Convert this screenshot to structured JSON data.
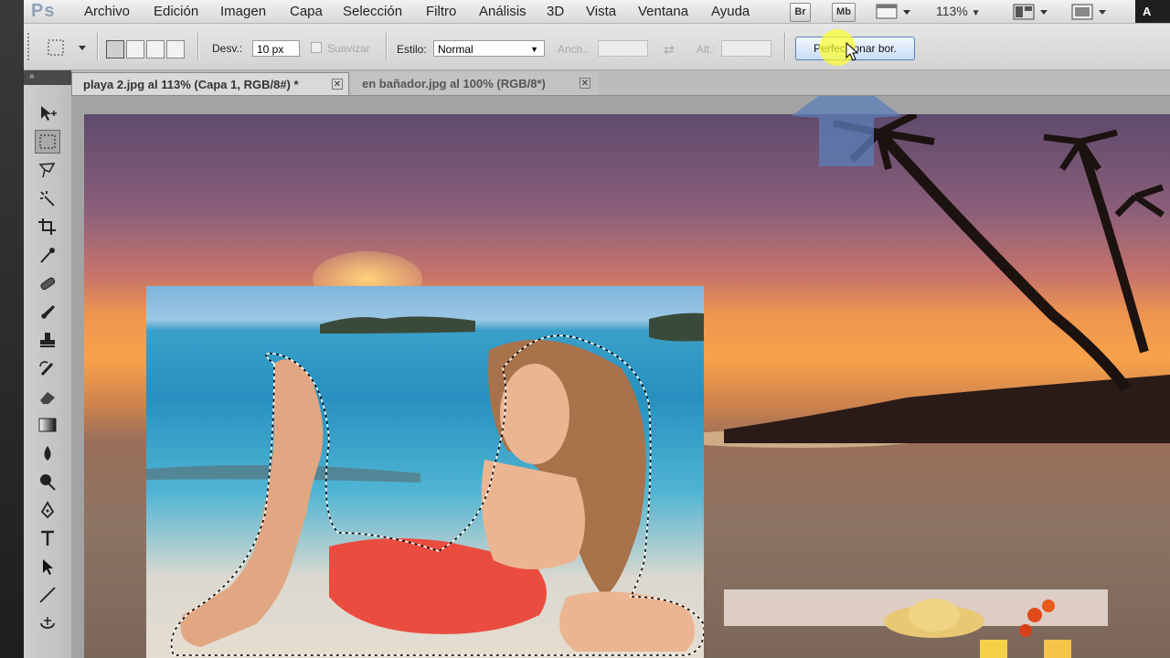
{
  "app": {
    "logo": "Ps"
  },
  "menu": [
    "Archivo",
    "Edición",
    "Imagen",
    "Capa",
    "Selección",
    "Filtro",
    "Análisis",
    "3D",
    "Vista",
    "Ventana",
    "Ayuda"
  ],
  "toolbar_right": {
    "bridge": "Br",
    "mini_bridge": "Mb",
    "zoom": "113%",
    "workspace": "A"
  },
  "options": {
    "feather_label": "Desv.:",
    "feather_value": "10 px",
    "antialias_label": "Suavizar",
    "style_label": "Estilo:",
    "style_value": "Normal",
    "width_label": "Anch.:",
    "height_label": "Alt.:",
    "refine_button": "Perfeccionar bor."
  },
  "tabs": [
    {
      "label": "playa 2.jpg al 113% (Capa 1, RGB/8#) *"
    },
    {
      "label": "en bañador.jpg al 100% (RGB/8*)"
    }
  ],
  "colors": {
    "accent": "#5b7fb8",
    "highlight": "#ffff40"
  }
}
